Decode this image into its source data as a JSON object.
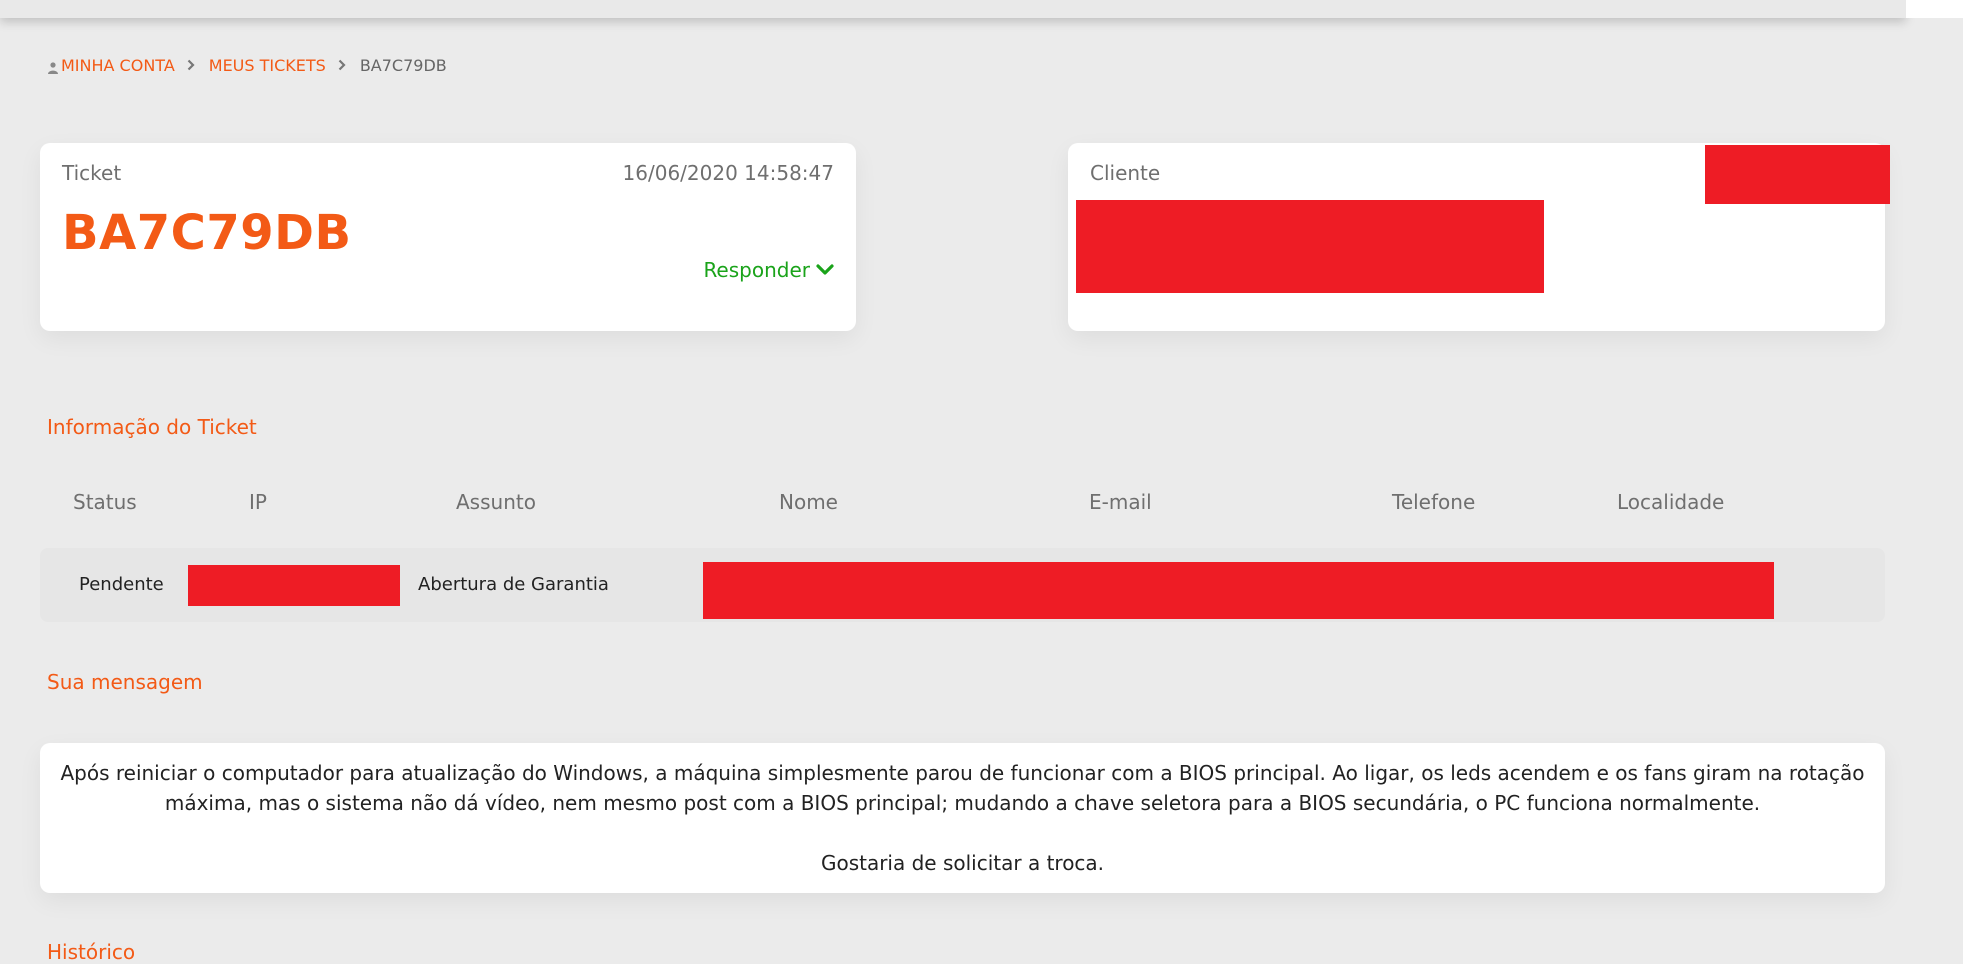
{
  "breadcrumb": {
    "account": "MINHA CONTA",
    "tickets": "MEUS TICKETS",
    "current": "BA7C79DB"
  },
  "ticket_card": {
    "label": "Ticket",
    "date": "16/06/2020 14:58:47",
    "code": "BA7C79DB",
    "reply_label": "Responder"
  },
  "client_card": {
    "label": "Cliente"
  },
  "info": {
    "title": "Informação do Ticket",
    "headers": {
      "status": "Status",
      "ip": "IP",
      "subject": "Assunto",
      "name": "Nome",
      "email": "E-mail",
      "phone": "Telefone",
      "location": "Localidade"
    },
    "row": {
      "status": "Pendente",
      "subject": "Abertura de Garantia"
    }
  },
  "message": {
    "title": "Sua mensagem",
    "paragraph1": "Após reiniciar o computador para atualização do Windows, a máquina simplesmente parou de funcionar com a BIOS principal. Ao ligar, os leds acendem e os fans giram na rotação máxima, mas o sistema não dá vídeo, nem mesmo post com a BIOS principal; mudando a chave seletora para a BIOS secundária, o PC funciona normalmente.",
    "paragraph2": "Gostaria de solicitar a troca."
  },
  "history": {
    "title": "Histórico"
  },
  "colors": {
    "accent": "#f35a16",
    "reply": "#1aa31a",
    "redaction": "#ee1c25",
    "background": "#ebebeb"
  },
  "icons": {
    "account": "user-icon",
    "separator": "chevron-right-icon",
    "reply": "chevron-down-icon"
  }
}
